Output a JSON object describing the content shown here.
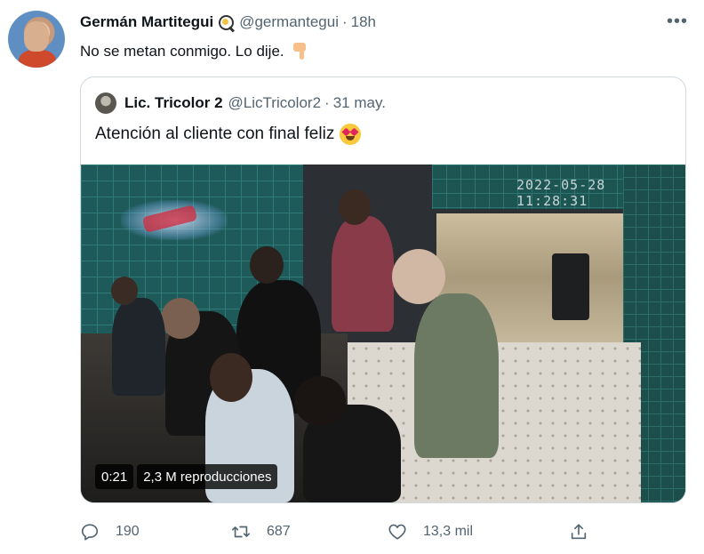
{
  "tweet": {
    "author_name": "Germán Martitegui",
    "author_emoji": "frying-pan-icon",
    "handle": "@germantegui",
    "separator": "·",
    "time": "18h",
    "more_label": "•••",
    "text": "No se metan conmigo. Lo dije.",
    "text_emoji": "pointing-down-icon"
  },
  "quoted": {
    "author_name": "Lic. Tricolor 2",
    "handle": "@LicTricolor2",
    "separator": "·",
    "time": "31 may.",
    "text": "Atención al cliente con final feliz",
    "text_emoji": "heart-eyes-icon",
    "video": {
      "overlay_timestamp": "2022-05-28 11:28:31",
      "duration": "0:21",
      "views": "2,3 M reproducciones"
    }
  },
  "actions": {
    "replies": "190",
    "retweets": "687",
    "likes": "13,3 mil"
  },
  "colors": {
    "text_primary": "#0f1419",
    "text_secondary": "#536471",
    "border": "#cfd9de"
  }
}
